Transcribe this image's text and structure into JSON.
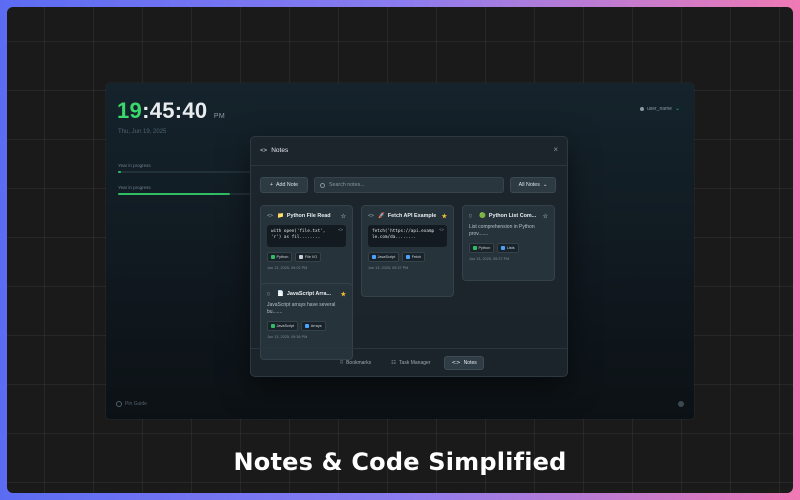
{
  "colors": {
    "accent_green": "#39d96c",
    "star_yellow": "#f2c230",
    "frame_gradient": [
      "#5b6cf3",
      "#f07ab4"
    ]
  },
  "background_app": {
    "clock": {
      "hours": "19",
      "rest": ":45:40",
      "suffix": "PM"
    },
    "date": "Thu, Jun 19, 2025",
    "progress_bars": [
      {
        "label": "Year in progress",
        "value": 0.02
      },
      {
        "label": "Year in progress",
        "value": 0.8
      }
    ],
    "user": {
      "name": "user_name"
    },
    "bottom_left_label": "Pin Guide"
  },
  "modal": {
    "title": "Notes",
    "title_icon": "code-icon",
    "close_label": "×",
    "toolbar": {
      "add_label": "Add Note",
      "search_placeholder": "Search notes...",
      "filter_label": "All Notes"
    },
    "notes": [
      {
        "type": "code",
        "type_glyph": "<>",
        "emoji": "📁",
        "title": "Python File Read",
        "starred": false,
        "code_lines": [
          "with open('file.txt',",
          "'r') as fil........"
        ],
        "tags": [
          {
            "label": "Python",
            "color": "#2fbe63"
          },
          {
            "label": "File I/O",
            "color": "#c9d0d5"
          }
        ],
        "date": "Jun 13, 2025, 09:02 PM"
      },
      {
        "type": "code",
        "type_glyph": "<>",
        "emoji": "🚀",
        "title": "Fetch API Example",
        "starred": true,
        "code_lines": [
          "fetch('https://api.examp",
          "le.com/da........"
        ],
        "tags": [
          {
            "label": "JavaScript",
            "color": "#4aa3ff"
          },
          {
            "label": "Fetch",
            "color": "#4aa3ff"
          }
        ],
        "date": "Jun 13, 2025, 09:37 PM"
      },
      {
        "type": "text",
        "type_glyph": "▢",
        "emoji": "🟢",
        "title": "Python List Com...",
        "starred": false,
        "text": "List comprehension in Python prov.......",
        "tags": [
          {
            "label": "Python",
            "color": "#2fbe63"
          },
          {
            "label": "Lists",
            "color": "#4aa3ff"
          }
        ],
        "date": "Jun 13, 2025, 09:27 PM"
      },
      {
        "type": "text",
        "type_glyph": "▢",
        "emoji": "📄",
        "title": "JavaScript Arra...",
        "starred": true,
        "text": "JavaScript arrays have several bu.......",
        "tags": [
          {
            "label": "JavaScript",
            "color": "#2fbe63"
          },
          {
            "label": "Arrays",
            "color": "#4aa3ff"
          }
        ],
        "date": "Jun 13, 2025, 09:36 PM"
      }
    ],
    "footer_nav": [
      {
        "label": "Bookmarks",
        "icon": "bookmark-icon",
        "glyph": "⌑",
        "active": false
      },
      {
        "label": "Task Manager",
        "icon": "task-icon",
        "glyph": "☷",
        "active": false
      },
      {
        "label": "Notes",
        "icon": "code-icon",
        "glyph": "<>",
        "active": true
      }
    ]
  },
  "tagline": "Notes & Code Simplified"
}
